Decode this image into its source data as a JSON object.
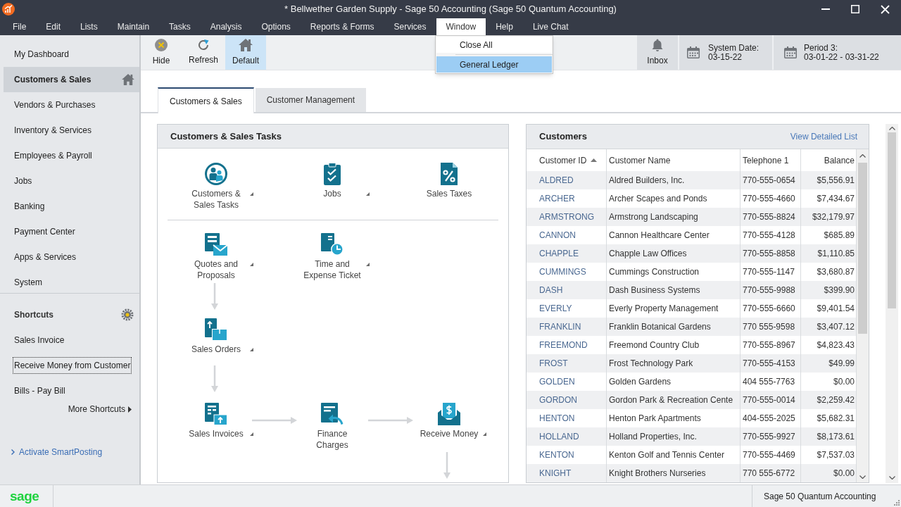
{
  "window": {
    "title": "* Bellwether Garden Supply - Sage 50 Accounting (Sage 50 Quantum Accounting)"
  },
  "menu_bar": [
    {
      "label": "File",
      "selected": false
    },
    {
      "label": "Edit",
      "selected": false
    },
    {
      "label": "Lists",
      "selected": false
    },
    {
      "label": "Maintain",
      "selected": false
    },
    {
      "label": "Tasks",
      "selected": false
    },
    {
      "label": "Analysis",
      "selected": false
    },
    {
      "label": "Options",
      "selected": false
    },
    {
      "label": "Reports & Forms",
      "selected": false
    },
    {
      "label": "Services",
      "selected": false
    },
    {
      "label": "Window",
      "selected": true
    },
    {
      "label": "Help",
      "selected": false
    },
    {
      "label": "Live Chat",
      "selected": false
    }
  ],
  "window_menu": {
    "items": [
      {
        "label": "Close All",
        "selected": false
      },
      {
        "label": "General Ledger",
        "selected": true
      }
    ]
  },
  "toolbar": {
    "buttons": [
      {
        "label": "Hide",
        "kind": "hide",
        "selected": false
      },
      {
        "label": "Refresh",
        "kind": "refresh",
        "selected": false
      },
      {
        "label": "Default",
        "kind": "home",
        "selected": true
      }
    ],
    "inbox": {
      "label": "Inbox"
    },
    "system_date": {
      "label": "System Date:",
      "value": "03-15-22"
    },
    "period": {
      "label": "Period 3:",
      "value": "03-01-22 - 03-31-22"
    }
  },
  "sidebar": {
    "items": [
      {
        "label": "My Dashboard",
        "selected": false
      },
      {
        "label": "Customers & Sales",
        "selected": true
      },
      {
        "label": "Vendors & Purchases",
        "selected": false
      },
      {
        "label": "Inventory & Services",
        "selected": false
      },
      {
        "label": "Employees & Payroll",
        "selected": false
      },
      {
        "label": "Jobs",
        "selected": false
      },
      {
        "label": "Banking",
        "selected": false
      },
      {
        "label": "Payment Center",
        "selected": false
      },
      {
        "label": "Apps & Services",
        "selected": false
      },
      {
        "label": "System",
        "selected": false
      }
    ],
    "shortcuts": {
      "title": "Shortcuts",
      "items": [
        {
          "label": "Sales Invoice",
          "focused": false
        },
        {
          "label": "Receive Money from Customer",
          "focused": true
        },
        {
          "label": "Bills - Pay Bill",
          "focused": false
        }
      ],
      "more": "More Shortcuts"
    },
    "smart_posting": "Activate SmartPosting"
  },
  "tabs": [
    {
      "label": "Customers & Sales",
      "selected": true
    },
    {
      "label": "Customer Management",
      "selected": false
    }
  ],
  "tasks_panel": {
    "title": "Customers & Sales Tasks",
    "tasks": [
      {
        "label": "Customers & Sales Tasks",
        "kind": "people",
        "has_menu": true
      },
      {
        "label": "Jobs",
        "kind": "clipboard",
        "has_menu": true
      },
      {
        "label": "Sales Taxes",
        "kind": "percent",
        "has_menu": false
      },
      {
        "label": "Quotes and Proposals",
        "kind": "quote",
        "has_menu": true
      },
      {
        "label": "Time and Expense Ticket",
        "kind": "time",
        "has_menu": true
      },
      {
        "label": "Sales Orders",
        "kind": "order",
        "has_menu": true
      },
      {
        "label": "Sales Invoices",
        "kind": "invoice",
        "has_menu": true
      },
      {
        "label": "Finance Charges",
        "kind": "finance",
        "has_menu": false
      },
      {
        "label": "Receive Money",
        "kind": "money",
        "has_menu": true
      }
    ]
  },
  "customers_panel": {
    "title": "Customers",
    "link": "View Detailed List",
    "table": {
      "columns": [
        {
          "label": "Customer ID",
          "kind": "id",
          "sorted": true
        },
        {
          "label": "Customer Name",
          "kind": "text",
          "sorted": false
        },
        {
          "label": "Telephone 1",
          "kind": "phone",
          "sorted": false
        },
        {
          "label": "Balance",
          "kind": "money",
          "sorted": false
        }
      ],
      "rows": [
        [
          "ALDRED",
          "Aldred Builders, Inc.",
          "770-555-0654",
          "$5,556.91"
        ],
        [
          "ARCHER",
          "Archer Scapes and Ponds",
          "770-555-4660",
          "$7,434.67"
        ],
        [
          "ARMSTRONG",
          "Armstrong Landscaping",
          "770-555-8824",
          "$32,179.97"
        ],
        [
          "CANNON",
          "Cannon Healthcare Center",
          "770-555-4128",
          "$685.89"
        ],
        [
          "CHAPPLE",
          "Chapple Law Offices",
          "770-555-8858",
          "$1,110.85"
        ],
        [
          "CUMMINGS",
          "Cummings Construction",
          "770-555-1147",
          "$3,680.87"
        ],
        [
          "DASH",
          "Dash Business Systems",
          "770-555-9988",
          "$399.90"
        ],
        [
          "EVERLY",
          "Everly Property Management",
          "770-555-6660",
          "$9,401.54"
        ],
        [
          "FRANKLIN",
          "Franklin Botanical Gardens",
          "770 555-9598",
          "$3,407.12"
        ],
        [
          "FREEMOND",
          "Freemond Country Club",
          "770-555-8967",
          "$4,823.43"
        ],
        [
          "FROST",
          "Frost Technology Park",
          "770-555-4153",
          "$49.99"
        ],
        [
          "GOLDEN",
          "Golden Gardens",
          "404 555-7763",
          "$0.00"
        ],
        [
          "GORDON",
          "Gordon Park & Recreation Cente",
          "770-555-0014",
          "$2,259.42"
        ],
        [
          "HENTON",
          "Henton Park Apartments",
          "404-555-2025",
          "$5,682.31"
        ],
        [
          "HOLLAND",
          "Holland Properties, Inc.",
          "770-555-9927",
          "$8,173.61"
        ],
        [
          "KENTON",
          "Kenton Golf and Tennis Center",
          "770-555-4469",
          "$7,537.03"
        ],
        [
          "KNIGHT",
          "Knight Brothers Nurseries",
          "770 555-6772",
          "$0.00"
        ]
      ]
    }
  },
  "status_bar": {
    "logo": "sage",
    "text": "Sage 50 Quantum Accounting"
  }
}
